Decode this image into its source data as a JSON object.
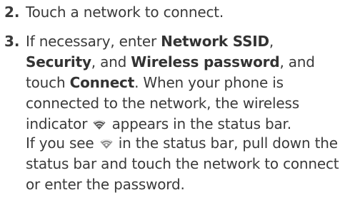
{
  "step2": {
    "number": "2.",
    "text": "Touch a network to connect."
  },
  "step3": {
    "number": "3.",
    "t1": "If necessary, enter ",
    "b1": "Network SSID",
    "t2": ", ",
    "b2": "Security",
    "t3": ", and ",
    "b3": "Wireless password",
    "t4": ", and touch ",
    "b4": "Connect",
    "t5": ". When your phone is connected to the network, the wireless indicator ",
    "icon1": "wifi-connected-icon",
    "t6": " appears in the status bar."
  },
  "note": {
    "t1": "If you see ",
    "icon": "wifi-available-icon",
    "t2": " in the status bar, pull down the status bar and touch the network to connect or enter the password."
  }
}
